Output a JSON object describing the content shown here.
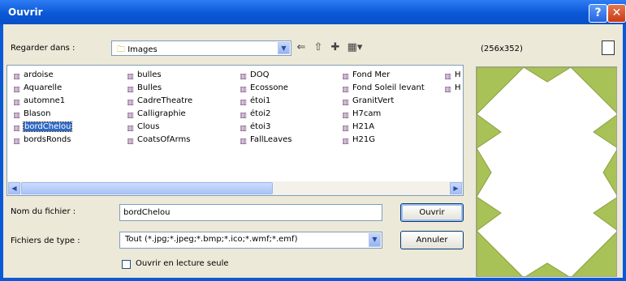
{
  "window": {
    "title": "Ouvrir",
    "help": "?",
    "close": "✕"
  },
  "lookin": {
    "label": "Regarder dans :",
    "value": "Images"
  },
  "toolbar": {
    "back": "⇐",
    "up": "⇧",
    "newfolder": "✚",
    "views": "▦▾"
  },
  "files": [
    {
      "name": "ardoise",
      "col": 0,
      "row": 0
    },
    {
      "name": "Aquarelle",
      "col": 0,
      "row": 1
    },
    {
      "name": "automne1",
      "col": 0,
      "row": 2
    },
    {
      "name": "Blason",
      "col": 0,
      "row": 3
    },
    {
      "name": "bordChelou",
      "col": 0,
      "row": 4,
      "selected": true
    },
    {
      "name": "bordsRonds",
      "col": 0,
      "row": 5
    },
    {
      "name": "bulles",
      "col": 1,
      "row": 0
    },
    {
      "name": "Bulles",
      "col": 1,
      "row": 1
    },
    {
      "name": "CadreTheatre",
      "col": 1,
      "row": 2
    },
    {
      "name": "Calligraphie",
      "col": 1,
      "row": 3
    },
    {
      "name": "Clous",
      "col": 1,
      "row": 4
    },
    {
      "name": "CoatsOfArms",
      "col": 1,
      "row": 5
    },
    {
      "name": "DOQ",
      "col": 2,
      "row": 0
    },
    {
      "name": "Ecossone",
      "col": 2,
      "row": 1
    },
    {
      "name": "étoi1",
      "col": 2,
      "row": 2
    },
    {
      "name": "étoi2",
      "col": 2,
      "row": 3
    },
    {
      "name": "étoi3",
      "col": 2,
      "row": 4
    },
    {
      "name": "FallLeaves",
      "col": 2,
      "row": 5
    },
    {
      "name": "Fond Mer",
      "col": 3,
      "row": 0
    },
    {
      "name": "Fond Soleil levant",
      "col": 3,
      "row": 1
    },
    {
      "name": "GranitVert",
      "col": 3,
      "row": 2
    },
    {
      "name": "H7cam",
      "col": 3,
      "row": 3
    },
    {
      "name": "H21A",
      "col": 3,
      "row": 4
    },
    {
      "name": "H21G",
      "col": 3,
      "row": 5
    },
    {
      "name": "H",
      "col": 4,
      "row": 0
    },
    {
      "name": "H",
      "col": 4,
      "row": 1
    }
  ],
  "filename": {
    "label": "Nom du fichier :",
    "value": "bordChelou"
  },
  "filetype": {
    "label": "Fichiers de type :",
    "value": "Tout (*.jpg;*.jpeg;*.bmp;*.ico;*.wmf;*.emf)"
  },
  "buttons": {
    "open": "Ouvrir",
    "cancel": "Annuler"
  },
  "readonly": {
    "label": "Ouvrir en lecture seule",
    "checked": false
  },
  "preview": {
    "dimensions": "(256x352)",
    "frame_color": "#a8c257"
  }
}
